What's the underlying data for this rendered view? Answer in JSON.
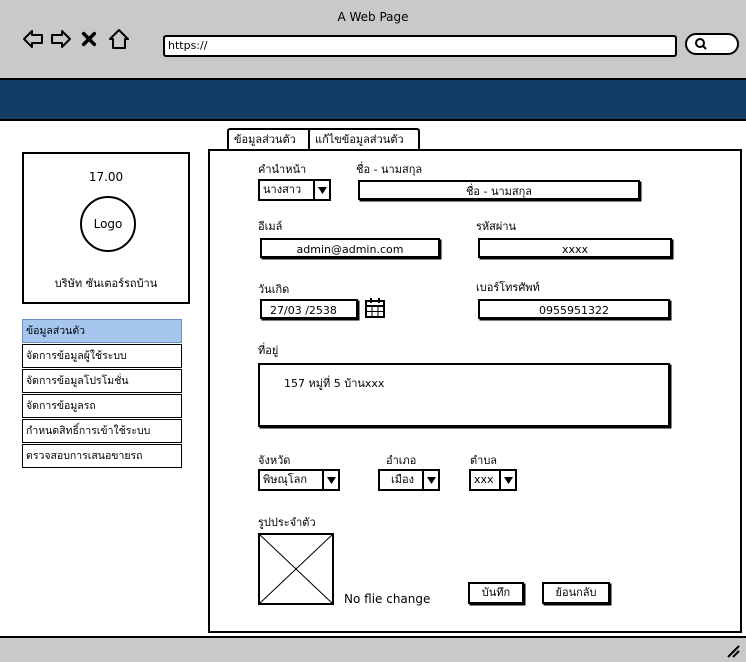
{
  "window": {
    "title": "A Web Page"
  },
  "browser": {
    "url": "https://"
  },
  "tabs": [
    {
      "label": "ข้อมูลส่วนตัว"
    },
    {
      "label": "แก้ไขข้อมูลส่วนตัว"
    }
  ],
  "sidebar": {
    "time": "17.00",
    "logo": "Logo",
    "company": "บริษัท ซันเตอร์รถบ้าน",
    "menu": [
      {
        "label": "ข้อมูลส่วนตัว",
        "active": true
      },
      {
        "label": "จัดการข้อมูลผู้ใช้ระบบ"
      },
      {
        "label": "จัดการข้อมูลโปรโมชั่น"
      },
      {
        "label": "จัดการข้อมูลรถ"
      },
      {
        "label": "กำหนดสิทธิ์การเข้าใช้ระบบ"
      },
      {
        "label": "ตรวจสอบการเสนอขายรถ"
      }
    ]
  },
  "form": {
    "prefix_label": "คำนำหน้า",
    "prefix_value": "นางสาว",
    "name_label": "ชื่อ - นามสกุล",
    "name_value": "ชื่อ - นามสกุล",
    "email_label": "อีเมล์",
    "email_value": "admin@admin.com",
    "password_label": "รหัสผ่าน",
    "password_value": "xxxx",
    "birth_label": "วันเกิด",
    "birth_value": "27/03 /2538",
    "phone_label": "เบอร์โทรศัพท์",
    "phone_value": "0955951322",
    "address_label": "ที่อยู่",
    "address_value": "157 หมู่ที่ 5 บ้านxxx",
    "province_label": "จังหวัด",
    "province_value": "พิษณุโลก",
    "district_label": "อำเภอ",
    "district_value": "เมือง",
    "subdistrict_label": "ตำบล",
    "subdistrict_value": "xxx",
    "photo_label": "รูปประจำตัว",
    "file_status": "No flie change",
    "save_label": "บันทึก",
    "back_label": "ย้อนกลับ"
  }
}
